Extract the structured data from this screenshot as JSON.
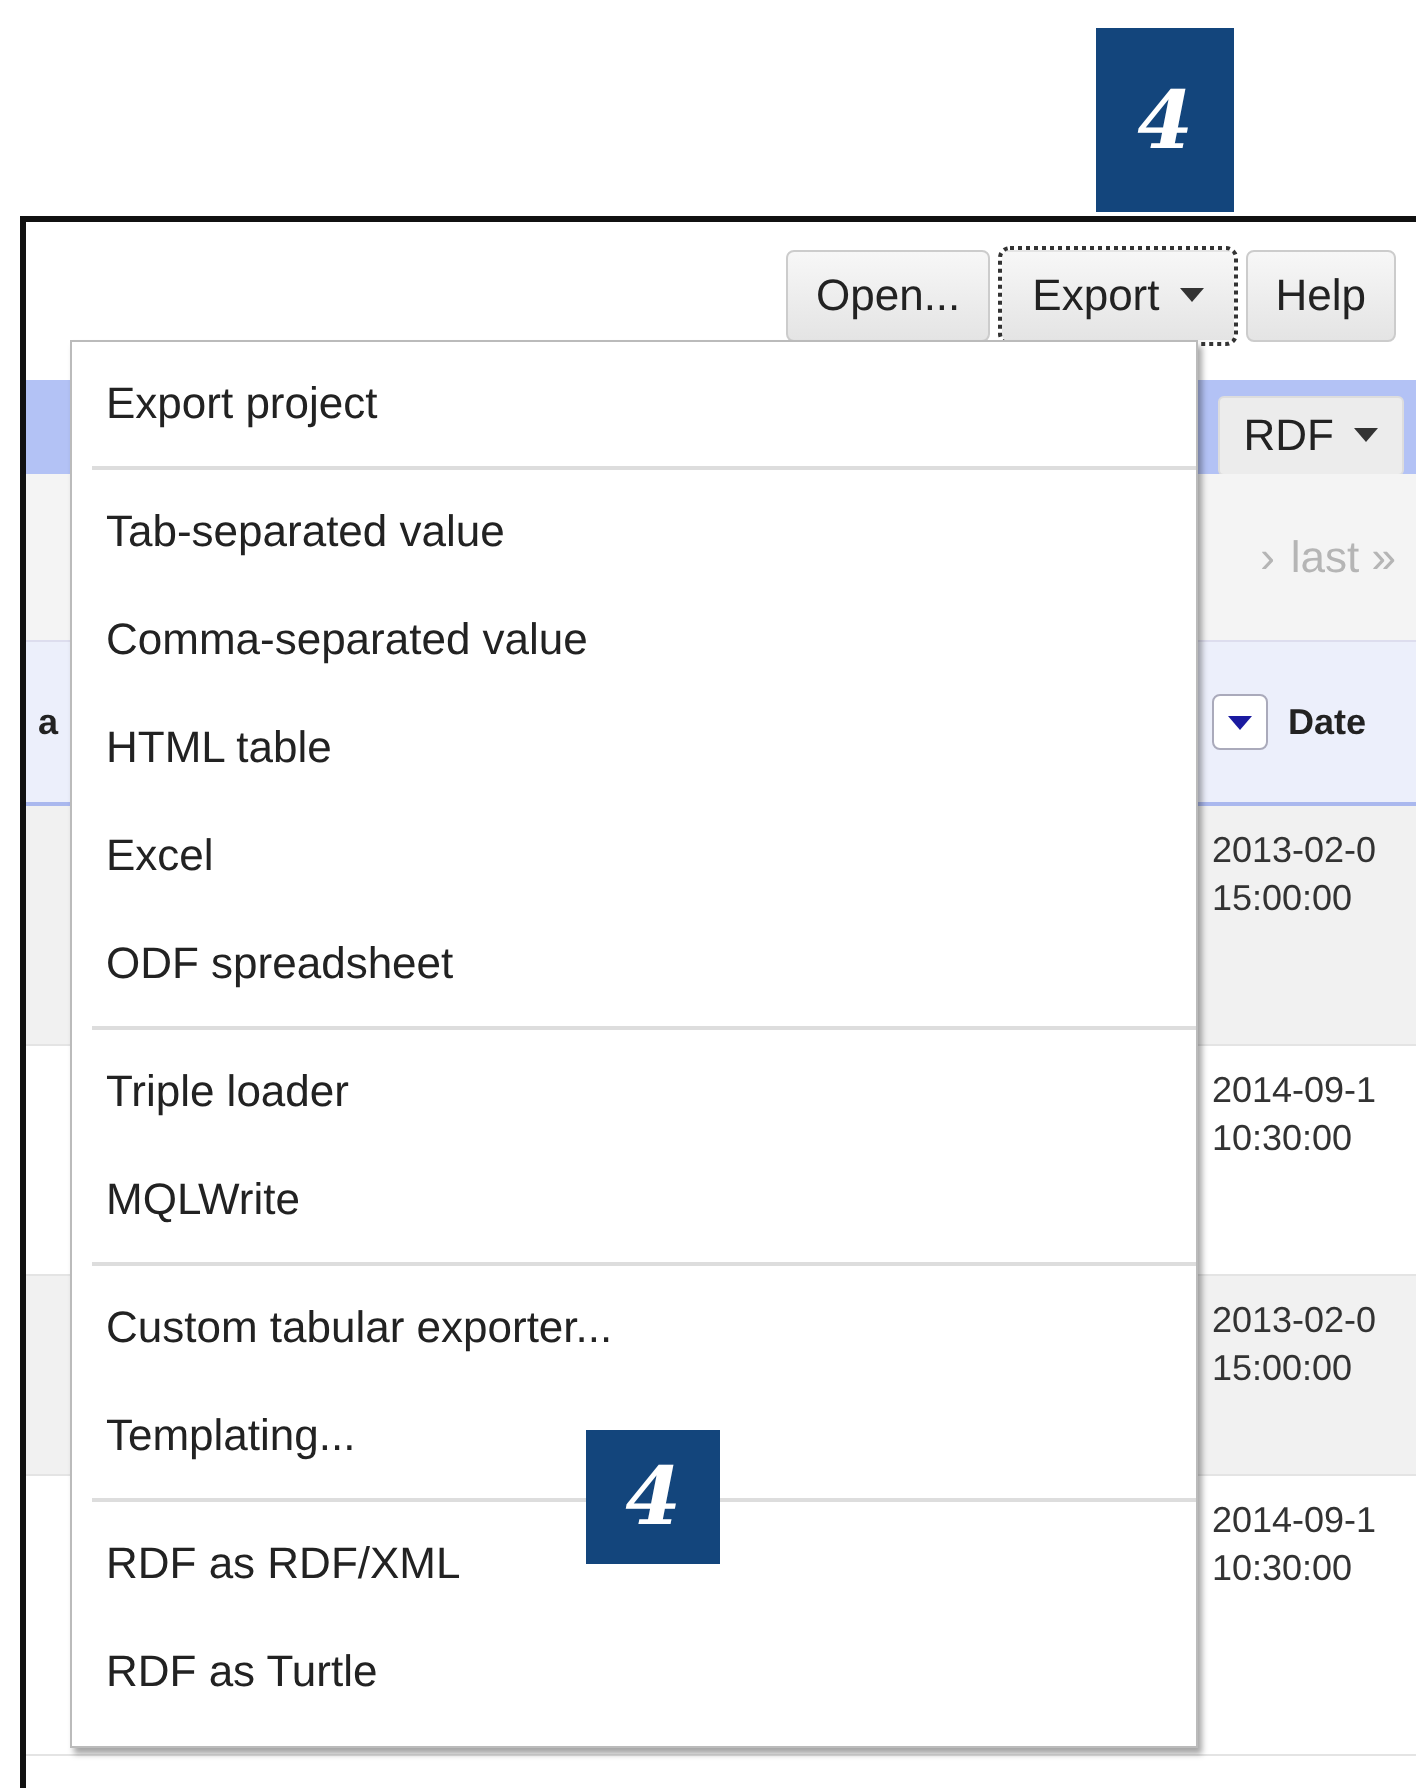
{
  "badges": [
    {
      "label": "4"
    },
    {
      "label": "4"
    }
  ],
  "toolbar": {
    "buttons": [
      {
        "label": "Open...",
        "caret": false,
        "focused": false
      },
      {
        "label": "Export",
        "caret": true,
        "focused": true
      },
      {
        "label": "Help",
        "caret": false,
        "focused": false
      }
    ]
  },
  "format_button": {
    "label": "RDF",
    "caret": true
  },
  "pager": {
    "next": "›",
    "last": "last »"
  },
  "table": {
    "columns": [
      {
        "label": "a",
        "sort_button": false
      },
      {
        "label": "Date",
        "sort_button": true
      }
    ],
    "rows": [
      {
        "date": "2013-02-0",
        "time": "15:00:00"
      },
      {
        "date": "2014-09-1",
        "time": "10:30:00"
      },
      {
        "date": "2013-02-0",
        "time": "15:00:00"
      },
      {
        "date": "2014-09-1",
        "time": "10:30:00"
      }
    ]
  },
  "export_menu": {
    "sections": [
      {
        "items": [
          "Export project"
        ]
      },
      {
        "items": [
          "Tab-separated value",
          "Comma-separated value",
          "HTML table",
          "Excel",
          "ODF spreadsheet"
        ]
      },
      {
        "items": [
          "Triple loader",
          "MQLWrite"
        ]
      },
      {
        "items": [
          "Custom tabular exporter...",
          "Templating..."
        ]
      },
      {
        "items": [
          "RDF as RDF/XML",
          "RDF as Turtle"
        ]
      }
    ]
  }
}
